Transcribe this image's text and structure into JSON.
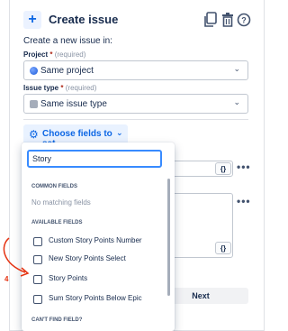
{
  "header": {
    "add_icon": "plus-icon",
    "title": "Create issue",
    "icons": [
      "copy-icon",
      "trash-icon",
      "help-icon"
    ]
  },
  "subtitle": "Create a new issue in:",
  "project": {
    "label": "Project",
    "required_mark": "*",
    "hint": "(required)",
    "value": "Same project",
    "icon": "globe-icon"
  },
  "issue_type": {
    "label": "Issue type",
    "required_mark": "*",
    "hint": "(required)",
    "value": "Same issue type",
    "icon": "issue-type-icon"
  },
  "choose_fields": {
    "label": "Choose fields to set..."
  },
  "dropdown": {
    "search_value": "Story",
    "common_header": "COMMON FIELDS",
    "no_matching": "No matching fields",
    "available_header": "AVAILABLE FIELDS",
    "available": [
      "Custom Story Points Number",
      "New Story Points Select",
      "Story Points",
      "Sum Story Points Below Epic"
    ],
    "cant_find": "CAN'T FIND FIELD?"
  },
  "background": {
    "brace_label_1": "{}",
    "brace_label_2": "{}",
    "more_1": "•••",
    "more_2": "•••"
  },
  "footer": {
    "next_label": "Next"
  },
  "annotation": {
    "step_number": "4",
    "color": "#e53312"
  }
}
